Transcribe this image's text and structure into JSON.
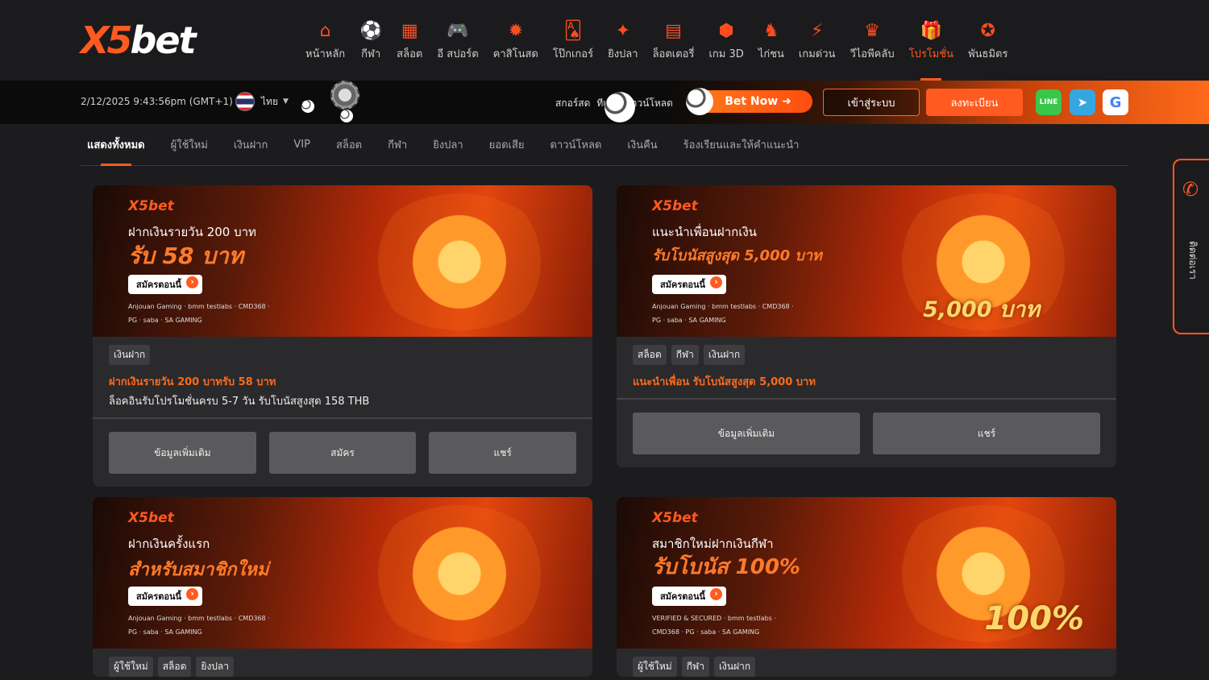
{
  "logo": {
    "x": "X5",
    "b": "bet"
  },
  "nav": [
    {
      "label": "หน้าหลัก",
      "icon": "home-icon",
      "glyph": "⌂"
    },
    {
      "label": "กีฬา",
      "icon": "soccer-ball-icon",
      "glyph": "⚽"
    },
    {
      "label": "สล็อต",
      "icon": "slot-machine-icon",
      "glyph": "▦"
    },
    {
      "label": "อี สปอร์ต",
      "icon": "gamepad-icon",
      "glyph": "🎮"
    },
    {
      "label": "คาสิโนสด",
      "icon": "casino-chip-icon",
      "glyph": "✹"
    },
    {
      "label": "โป๊กเกอร์",
      "icon": "cards-icon",
      "glyph": "🂡"
    },
    {
      "label": "ยิงปลา",
      "icon": "fish-icon",
      "glyph": "✦"
    },
    {
      "label": "ล็อตเตอรี่",
      "icon": "lottery-icon",
      "glyph": "▤"
    },
    {
      "label": "เกม 3D",
      "icon": "cube-icon",
      "glyph": "⬢"
    },
    {
      "label": "ไก่ชน",
      "icon": "rooster-icon",
      "glyph": "♞"
    },
    {
      "label": "เกมด่วน",
      "icon": "lightning-icon",
      "glyph": "⚡"
    },
    {
      "label": "วีไอพีคลับ",
      "icon": "crown-icon",
      "glyph": "♛"
    },
    {
      "label": "โปรโมชั่น",
      "icon": "gift-icon",
      "glyph": "🎁",
      "active": true
    },
    {
      "label": "พันธมิตร",
      "icon": "partner-icon",
      "glyph": "✪"
    }
  ],
  "strip": {
    "datetime": "2/12/2025 9:43:56pm (GMT+1)",
    "language": "ไทย",
    "links": [
      "สกอร์สด",
      "ทีเด็ด",
      "ดาวน์โหลด"
    ],
    "bet_now": "Bet Now ➜",
    "login": "เข้าสู่ระบบ",
    "register": "ลงทะเบียน",
    "social_line": "LINE",
    "social_tg": "➤",
    "social_g": "G"
  },
  "categories": [
    {
      "label": "แสดงทั้งหมด",
      "active": true
    },
    {
      "label": "ผู้ใช้ใหม่"
    },
    {
      "label": "เงินฝาก"
    },
    {
      "label": "VIP"
    },
    {
      "label": "สล็อต"
    },
    {
      "label": "กีฬา"
    },
    {
      "label": "ยิงปลา"
    },
    {
      "label": "ยอดเสีย"
    },
    {
      "label": "ดาวน์โหลด"
    },
    {
      "label": "เงินคืน"
    },
    {
      "label": "ร้องเรียนและให้คำแนะนำ"
    }
  ],
  "cards": [
    {
      "banner_sub": "ฝากเงินรายวัน 200 บาท",
      "banner_big": "รับ 58 บาท",
      "banner_cta": "สมัครตอนนี้",
      "banner_art": "",
      "partners": "Anjouan Gaming · bmm testlabs · CMD368 · PG · saba · SA GAMING",
      "tags": [
        "เงินฝาก"
      ],
      "title": "ฝากเงินรายวัน 200 บาทรับ 58 บาท",
      "desc": "ล็อคอินรับโปรโมชั่นครบ 5-7 วัน รับโบนัสสูงสุด 158 THB",
      "actions": [
        "ข้อมูลเพิ่มเติม",
        "สมัคร",
        "แชร์"
      ]
    },
    {
      "banner_sub": "แนะนำเพื่อนฝากเงิน",
      "banner_big": "รับโบนัสสูงสุด 5,000 บาท",
      "banner_cta": "สมัครตอนนี้",
      "banner_art": "5,000 บาท",
      "partners": "Anjouan Gaming · bmm testlabs · CMD368 · PG · saba · SA GAMING",
      "tags": [
        "สล็อต",
        "กีฬา",
        "เงินฝาก"
      ],
      "title": "แนะนำเพื่อน รับโบนัสสูงสุด 5,000 บาท",
      "desc": "",
      "actions": [
        "ข้อมูลเพิ่มเติม",
        "แชร์"
      ]
    },
    {
      "banner_sub": "ฝากเงินครั้งแรก",
      "banner_big": "สำหรับสมาชิกใหม่",
      "banner_cta": "สมัครตอนนี้",
      "banner_art": "",
      "partners": "Anjouan Gaming · bmm testlabs · CMD368 · PG · saba · SA GAMING",
      "tags": [
        "ผู้ใช้ใหม่",
        "สล็อต",
        "ยิงปลา"
      ]
    },
    {
      "banner_sub": "สมาชิกใหม่ฝากเงินกีฬา",
      "banner_big": "รับโบนัส 100%",
      "banner_cta": "สมัครตอนนี้",
      "banner_art": "100%",
      "partners": "VERIFIED & SECURED · bmm testlabs · CMD368 · PG · saba · SA GAMING",
      "tags": [
        "ผู้ใช้ใหม่",
        "กีฬา",
        "เงินฝาก"
      ]
    }
  ],
  "side_tab": {
    "label": "ติดต่อเรา"
  }
}
